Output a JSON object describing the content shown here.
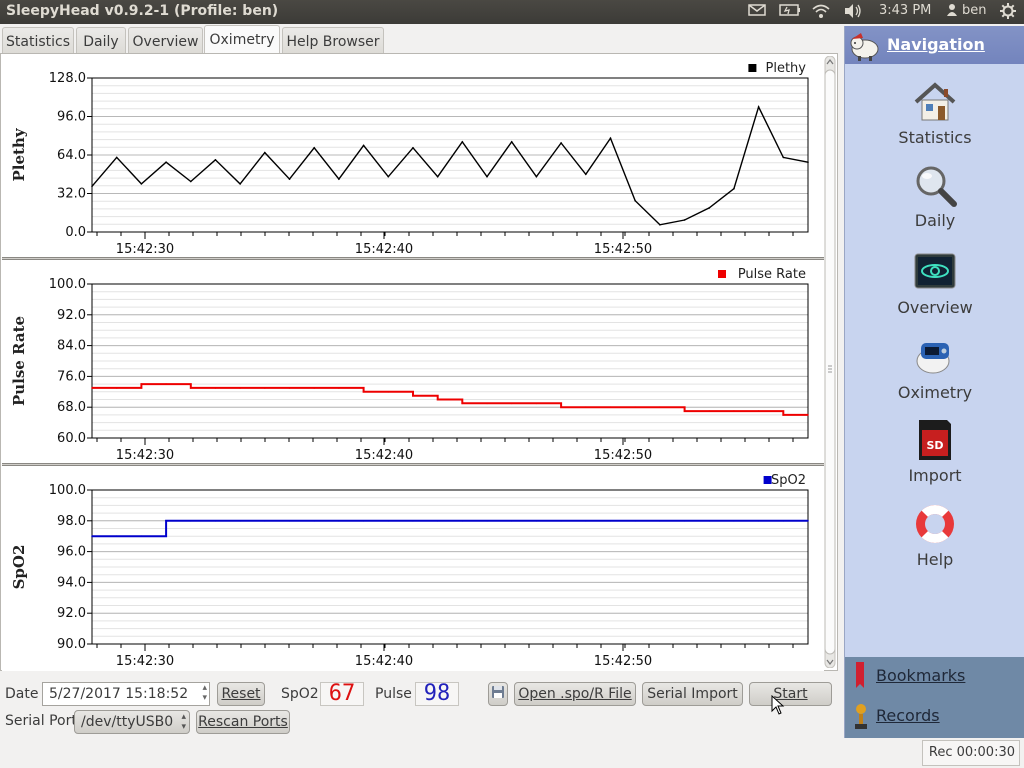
{
  "window": {
    "title": "SleepyHead v0.9.2-1  (Profile: ben)"
  },
  "tray": {
    "mail_icon": "mail-icon",
    "battery_icon": "battery-icon",
    "wifi_icon": "wifi-icon",
    "volume_icon": "volume-icon",
    "time": "3:43 PM",
    "user": "ben",
    "settings_icon": "gear-icon"
  },
  "tabs": [
    "Statistics",
    "Daily",
    "Overview",
    "Oximetry",
    "Help Browser"
  ],
  "active_tab": "Oximetry",
  "chart_data": [
    {
      "type": "line",
      "ylabel": "Plethy",
      "legend": "Plethy",
      "color": "#000000",
      "ylim": [
        0,
        128
      ],
      "yticks": [
        "128.0",
        "96.0",
        "64.0",
        "32.0",
        "0.0"
      ],
      "xticks": [
        "15:42:30",
        "15:42:40",
        "15:42:50"
      ],
      "series": [
        {
          "name": "Plethy",
          "x": [
            0,
            1,
            2,
            3,
            4,
            5,
            6,
            7,
            8,
            9,
            10,
            11,
            12,
            13,
            14,
            15,
            16,
            17,
            18,
            19,
            20,
            21,
            22,
            23,
            24,
            25,
            26,
            27,
            28,
            29
          ],
          "values": [
            38,
            62,
            40,
            58,
            42,
            60,
            40,
            66,
            44,
            70,
            44,
            72,
            46,
            70,
            46,
            75,
            46,
            75,
            46,
            74,
            48,
            78,
            26,
            6,
            10,
            20,
            36,
            104,
            62,
            58
          ]
        }
      ]
    },
    {
      "type": "line",
      "ylabel": "Pulse Rate",
      "legend": "Pulse Rate",
      "color": "#ee0000",
      "ylim": [
        60,
        100
      ],
      "yticks": [
        "100.0",
        "92.0",
        "84.0",
        "76.0",
        "68.0",
        "60.0"
      ],
      "xticks": [
        "15:42:30",
        "15:42:40",
        "15:42:50"
      ],
      "series": [
        {
          "name": "Pulse Rate",
          "x": [
            0,
            1,
            2,
            3,
            4,
            5,
            6,
            7,
            8,
            9,
            10,
            11,
            12,
            13,
            14,
            15,
            16,
            17,
            18,
            19,
            20,
            21,
            22,
            23,
            24,
            25,
            26,
            27,
            28,
            29
          ],
          "values": [
            73,
            73,
            74,
            74,
            73,
            73,
            73,
            73,
            73,
            73,
            73,
            72,
            72,
            71,
            70,
            69,
            69,
            69,
            69,
            68,
            68,
            68,
            68,
            68,
            67,
            67,
            67,
            67,
            66,
            66
          ]
        }
      ]
    },
    {
      "type": "line",
      "ylabel": "SpO2",
      "legend": "SpO2",
      "color": "#0000cc",
      "ylim": [
        90,
        100
      ],
      "yticks": [
        "100.0",
        "98.0",
        "96.0",
        "94.0",
        "92.0",
        "90.0"
      ],
      "xticks": [
        "15:42:30",
        "15:42:40",
        "15:42:50"
      ],
      "series": [
        {
          "name": "SpO2",
          "x": [
            0,
            1,
            2,
            3,
            4,
            5,
            6,
            7,
            8,
            9,
            10,
            11,
            12,
            13,
            14,
            15,
            16,
            17,
            18,
            19,
            20,
            21,
            22,
            23,
            24,
            25,
            26,
            27,
            28,
            29
          ],
          "values": [
            97,
            97,
            97,
            98,
            98,
            98,
            98,
            98,
            98,
            98,
            98,
            98,
            98,
            98,
            98,
            98,
            98,
            98,
            98,
            98,
            98,
            98,
            98,
            98,
            98,
            98,
            98,
            98,
            98,
            98
          ]
        }
      ]
    }
  ],
  "controls": {
    "date_label": "Date",
    "date_value": "5/27/2017 15:18:52",
    "reset_label": "Reset",
    "spo2_label": "SpO2",
    "spo2_value": "67",
    "pulse_label": "Pulse",
    "pulse_value": "98",
    "open_label": "Open .spo/R File",
    "serial_import_label": "Serial Import",
    "start_label": "Start",
    "serial_port_label": "Serial Port",
    "serial_port_value": "/dev/ttyUSB0",
    "rescan_label": "Rescan Ports"
  },
  "navigation": {
    "title": "Navigation",
    "items": [
      {
        "label": "Statistics",
        "icon": "house-icon"
      },
      {
        "label": "Daily",
        "icon": "magnifier-icon"
      },
      {
        "label": "Overview",
        "icon": "eye-icon"
      },
      {
        "label": "Oximetry",
        "icon": "oximeter-icon"
      },
      {
        "label": "Import",
        "icon": "sd-card-icon"
      },
      {
        "label": "Help",
        "icon": "lifebuoy-icon"
      }
    ],
    "bookmarks_label": "Bookmarks",
    "records_label": "Records"
  },
  "status": {
    "rec": "Rec 00:00:30"
  }
}
